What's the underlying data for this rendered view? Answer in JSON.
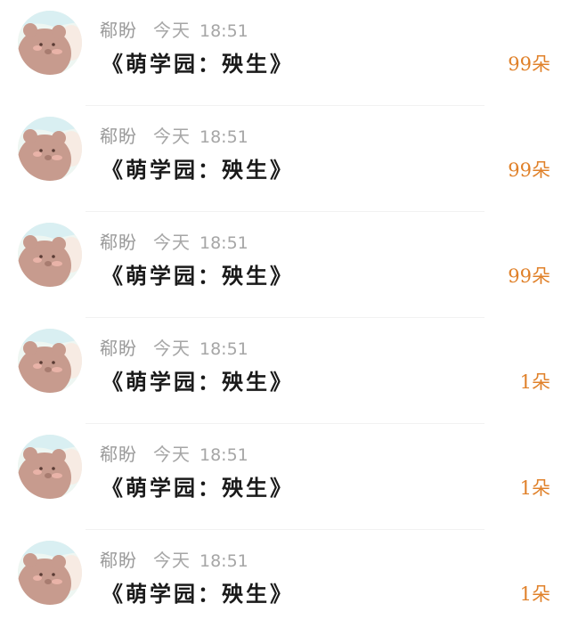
{
  "rows": [
    {
      "name": "郗盼",
      "date": "今天",
      "time": "18:51",
      "title": "《萌学园：殃生》",
      "count": "99朵"
    },
    {
      "name": "郗盼",
      "date": "今天",
      "time": "18:51",
      "title": "《萌学园：殃生》",
      "count": "99朵"
    },
    {
      "name": "郗盼",
      "date": "今天",
      "time": "18:51",
      "title": "《萌学园：殃生》",
      "count": "99朵"
    },
    {
      "name": "郗盼",
      "date": "今天",
      "time": "18:51",
      "title": "《萌学园：殃生》",
      "count": "1朵"
    },
    {
      "name": "郗盼",
      "date": "今天",
      "time": "18:51",
      "title": "《萌学园：殃生》",
      "count": "1朵"
    },
    {
      "name": "郗盼",
      "date": "今天",
      "time": "18:51",
      "title": "《萌学园：殃生》",
      "count": "1朵"
    }
  ],
  "colors": {
    "count_accent": "#e0812a",
    "name_gray": "#9a9a9a",
    "title_black": "#1a1a1a"
  },
  "icons": {
    "avatar": "bear-cartoon-avatar"
  }
}
